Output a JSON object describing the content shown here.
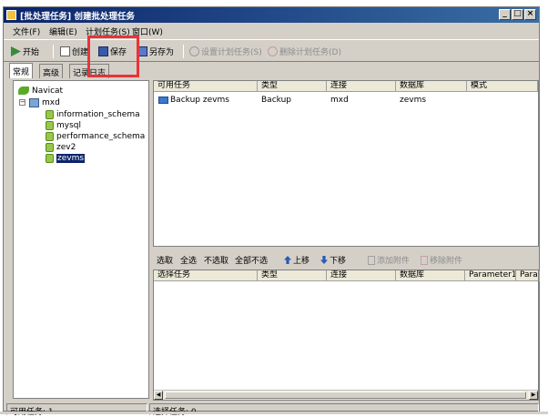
{
  "window": {
    "title": "[批处理任务] 创建批处理任务",
    "controls": {
      "minimize": "_",
      "maximize": "□",
      "close": "×"
    }
  },
  "menu": [
    {
      "label": "文件(F)"
    },
    {
      "label": "编辑(E)"
    },
    {
      "label": "计划任务(S)"
    },
    {
      "label": "窗口(W)"
    }
  ],
  "toolbar": {
    "start": "开始",
    "new": "创建",
    "save": "保存",
    "save_as": "另存为",
    "set_schedule": "设置计划任务(S)",
    "delete_schedule": "删除计划任务(D)"
  },
  "tabs": [
    {
      "label": "常规"
    },
    {
      "label": "高级"
    },
    {
      "label": "记录日志"
    }
  ],
  "tree": {
    "root": "Navicat",
    "connection": "mxd",
    "databases": [
      "information_schema",
      "mysql",
      "performance_schema",
      "zev2",
      "zevms"
    ],
    "selected_index": 4
  },
  "available_tasks": {
    "columns": [
      "可用任务",
      "类型",
      "连接",
      "数据库",
      "模式"
    ],
    "rows": [
      {
        "task": "Backup zevms",
        "type": "Backup",
        "connection": "mxd",
        "database": "zevms",
        "schema": ""
      }
    ]
  },
  "actions": {
    "select": "选取",
    "select_all": "全选",
    "deselect": "不选取",
    "deselect_all": "全部不选",
    "move_up": "上移",
    "move_down": "下移",
    "add_attachment": "添加附件",
    "remove_attachment": "移除附件"
  },
  "selected_tasks": {
    "columns": [
      "选择任务",
      "类型",
      "连接",
      "数据库",
      "Parameter1",
      "Para"
    ],
    "rows": []
  },
  "status": {
    "available": "可用任务: 1",
    "selected": "选择任务: 0"
  },
  "highlight_color": "#e8333a"
}
